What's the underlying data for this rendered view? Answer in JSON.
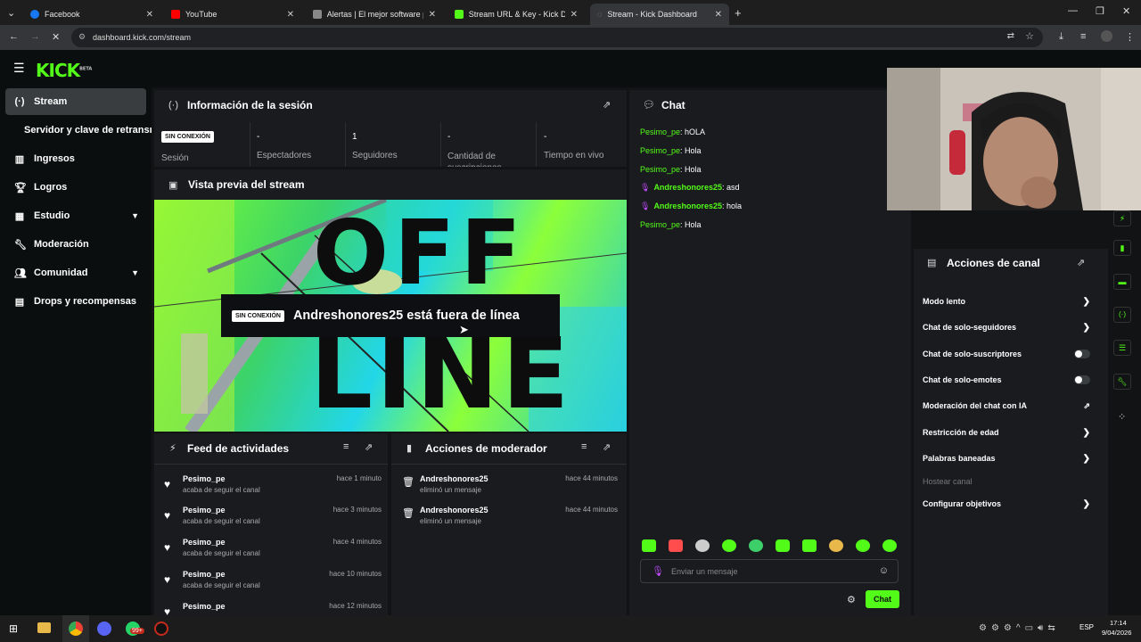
{
  "browser": {
    "tabs": [
      {
        "label": "Facebook",
        "color": "#1877f2"
      },
      {
        "label": "YouTube",
        "color": "#ff0000"
      },
      {
        "label": "Alertas | El mejor software para",
        "color": "#888888"
      },
      {
        "label": "Stream URL & Key - Kick Dashb",
        "color": "#53fc18"
      },
      {
        "label": "Stream - Kick Dashboard",
        "color": "#888888"
      }
    ],
    "url": "dashboard.kick.com/stream"
  },
  "header": {
    "logo": "KICK",
    "logo_sup": "BETA"
  },
  "sidebar": {
    "items": [
      {
        "label": "Stream",
        "icon": "broadcast-icon"
      },
      {
        "label": "Servidor y clave de retransmisión",
        "icon": ""
      },
      {
        "label": "Ingresos",
        "icon": "chart-icon"
      },
      {
        "label": "Logros",
        "icon": "trophy-icon"
      },
      {
        "label": "Estudio",
        "icon": "grid-icon"
      },
      {
        "label": "Moderación",
        "icon": "wrench-icon"
      },
      {
        "label": "Comunidad",
        "icon": "people-icon"
      },
      {
        "label": "Drops y recompensas",
        "icon": "gift-icon"
      }
    ]
  },
  "session": {
    "title": "Información de la sesión",
    "badge": "SIN CONEXIÓN",
    "session_label": "Sesión",
    "stats": [
      {
        "value": "-",
        "label": "Espectadores"
      },
      {
        "value": "1",
        "label": "Seguidores"
      },
      {
        "value": "-",
        "label": "Cantidad de suscripciones"
      },
      {
        "value": "-",
        "label": "Tiempo en vivo"
      }
    ]
  },
  "preview": {
    "title": "Vista previa del stream",
    "badge": "SIN CONEXIÓN",
    "offline_text": "Andreshonores25 está fuera de línea",
    "bg_word_1": "OFF",
    "bg_word_2": "LINE"
  },
  "feed": {
    "title": "Feed de actividades",
    "items": [
      {
        "name": "Pesimo_pe",
        "sub": "acaba de seguir el canal",
        "time": "hace 1 minuto"
      },
      {
        "name": "Pesimo_pe",
        "sub": "acaba de seguir el canal",
        "time": "hace 3 minutos"
      },
      {
        "name": "Pesimo_pe",
        "sub": "acaba de seguir el canal",
        "time": "hace 4 minutos"
      },
      {
        "name": "Pesimo_pe",
        "sub": "acaba de seguir el canal",
        "time": "hace 10 minutos"
      },
      {
        "name": "Pesimo_pe",
        "sub": "",
        "time": "hace 12 minutos"
      }
    ]
  },
  "modactions": {
    "title": "Acciones de moderador",
    "items": [
      {
        "name": "Andreshonores25",
        "sub": "eliminó un mensaje",
        "time": "hace 44 minutos"
      },
      {
        "name": "Andreshonores25",
        "sub": "eliminó un mensaje",
        "time": "hace 44 minutos"
      }
    ]
  },
  "chat": {
    "title": "Chat",
    "messages": [
      {
        "user": "Pesimo_pe",
        "text": ": hOLA",
        "mic": false
      },
      {
        "user": "Pesimo_pe",
        "text": ": Hola",
        "mic": false
      },
      {
        "user": "Pesimo_pe",
        "text": ": Hola",
        "mic": false
      },
      {
        "user": "Andreshonores25",
        "text": ": asd",
        "mic": true
      },
      {
        "user": "Andreshonores25",
        "text": ": hola",
        "mic": true
      },
      {
        "user": "Pesimo_pe",
        "text": ": Hola",
        "mic": false
      }
    ],
    "placeholder": "Enviar un mensaje",
    "send_label": "Chat"
  },
  "channel_actions": {
    "title": "Acciones de canal",
    "items": [
      {
        "label": "Modo lento",
        "control": "chevron"
      },
      {
        "label": "Chat de solo-seguidores",
        "control": "chevron"
      },
      {
        "label": "Chat de solo-suscriptores",
        "control": "toggle"
      },
      {
        "label": "Chat de solo-emotes",
        "control": "toggle"
      },
      {
        "label": "Moderación del chat con IA",
        "control": "external"
      },
      {
        "label": "Restricción de edad",
        "control": "chevron"
      },
      {
        "label": "Palabras baneadas",
        "control": "chevron"
      },
      {
        "label": "Hostear canal",
        "control": "disabled"
      },
      {
        "label": "Configurar objetivos",
        "control": "chevron"
      }
    ]
  },
  "taskbar": {
    "lang": "ESP",
    "time": "17:14",
    "date": "9/04/2026",
    "badge": "99+"
  },
  "colors": {
    "accent": "#53fc18",
    "panel": "#191b1f",
    "bg": "#111315"
  }
}
